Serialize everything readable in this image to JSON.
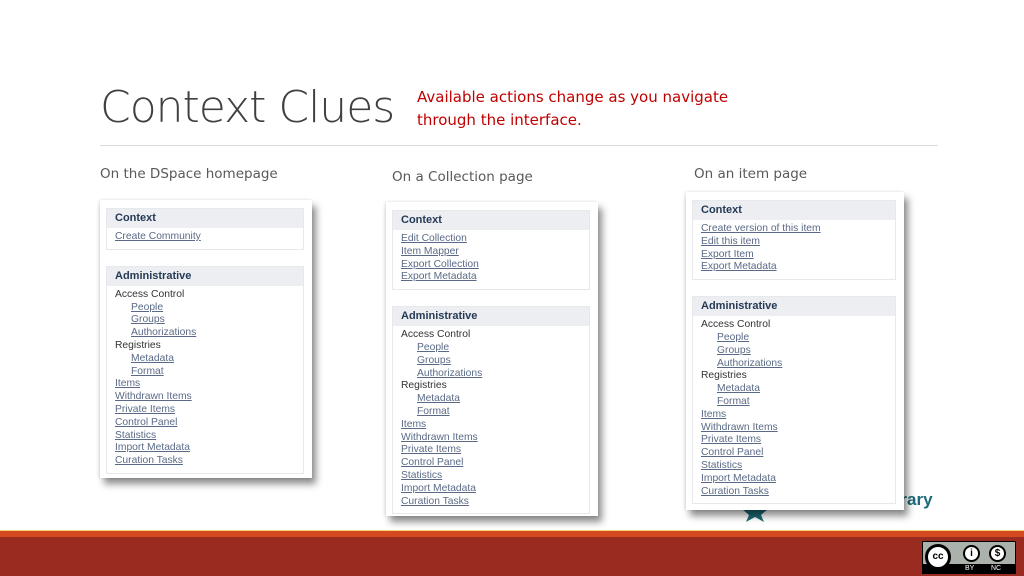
{
  "slide": {
    "title": "Context Clues",
    "subtitle": "Available actions change as you navigate through the interface.",
    "accent_color": "#c00000"
  },
  "columns": [
    {
      "caption": "On the DSpace homepage",
      "context": {
        "heading": "Context",
        "links": [
          "Create Community"
        ]
      },
      "administrative": {
        "heading": "Administrative",
        "access_control_label": "Access Control",
        "access_control": [
          "People",
          "Groups",
          "Authorizations"
        ],
        "registries_label": "Registries",
        "registries": [
          "Metadata",
          "Format"
        ],
        "links": [
          "Items",
          "Withdrawn Items",
          "Private Items",
          "Control Panel",
          "Statistics",
          "Import Metadata",
          "Curation Tasks"
        ]
      }
    },
    {
      "caption": "On a Collection page",
      "context": {
        "heading": "Context",
        "links": [
          "Edit Collection",
          "Item Mapper",
          "Export Collection",
          "Export Metadata"
        ]
      },
      "administrative": {
        "heading": "Administrative",
        "access_control_label": "Access Control",
        "access_control": [
          "People",
          "Groups",
          "Authorizations"
        ],
        "registries_label": "Registries",
        "registries": [
          "Metadata",
          "Format"
        ],
        "links": [
          "Items",
          "Withdrawn Items",
          "Private Items",
          "Control Panel",
          "Statistics",
          "Import Metadata",
          "Curation Tasks"
        ]
      }
    },
    {
      "caption": "On an item page",
      "context": {
        "heading": "Context",
        "links": [
          "Create version of this item",
          "Edit this item",
          "Export Item",
          "Export Metadata"
        ]
      },
      "administrative": {
        "heading": "Administrative",
        "access_control_label": "Access Control",
        "access_control": [
          "People",
          "Groups",
          "Authorizations"
        ],
        "registries_label": "Registries",
        "registries": [
          "Metadata",
          "Format"
        ],
        "links": [
          "Items",
          "Withdrawn Items",
          "Private Items",
          "Control Panel",
          "Statistics",
          "Import Metadata",
          "Curation Tasks"
        ]
      }
    }
  ],
  "logo": {
    "text_visible": "brary",
    "icon": "star-icon"
  },
  "license": {
    "icon": "creative-commons-icon",
    "cc": "cc",
    "by": "BY",
    "nc": "NC"
  }
}
